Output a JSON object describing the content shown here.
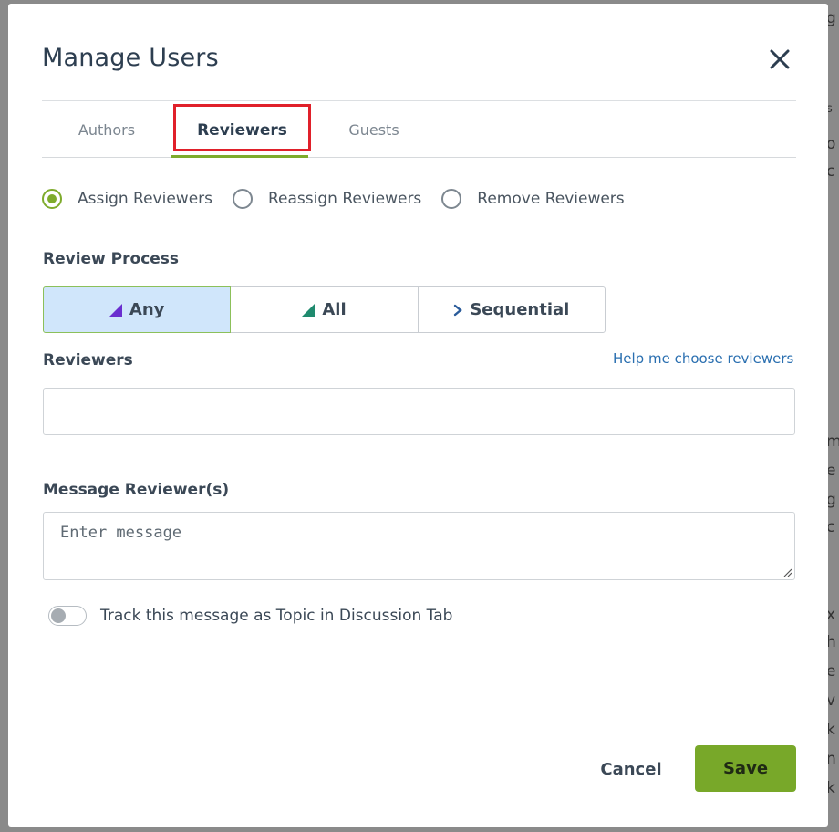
{
  "dialog": {
    "title": "Manage Users",
    "close_icon": "close-icon"
  },
  "tabs": [
    {
      "label": "Authors",
      "active": false
    },
    {
      "label": "Reviewers",
      "active": true
    },
    {
      "label": "Guests",
      "active": false
    }
  ],
  "assign_mode": {
    "options": [
      {
        "label": "Assign Reviewers",
        "checked": true
      },
      {
        "label": "Reassign Reviewers",
        "checked": false
      },
      {
        "label": "Remove Reviewers",
        "checked": false
      }
    ]
  },
  "review_process": {
    "label": "Review Process",
    "options": [
      {
        "label": "Any",
        "icon": "triangle-icon",
        "icon_color": "#6a2ecf",
        "selected": true
      },
      {
        "label": "All",
        "icon": "triangle-icon",
        "icon_color": "#1f8a6e",
        "selected": false
      },
      {
        "label": "Sequential",
        "icon": "chevron-right-icon",
        "icon_color": "#2a5b9a",
        "selected": false
      }
    ]
  },
  "reviewers": {
    "label": "Reviewers",
    "help_link": "Help me choose reviewers",
    "value": ""
  },
  "message": {
    "label": "Message Reviewer(s)",
    "placeholder": "Enter message",
    "value": ""
  },
  "track_toggle": {
    "label": "Track this message as Topic in Discussion Tab",
    "on": false
  },
  "footer": {
    "cancel_label": "Cancel",
    "save_label": "Save"
  },
  "colors": {
    "accent": "#78a829",
    "highlight_box": "#e0202a",
    "selected_segment": "#d0e6fb",
    "link": "#2a6fb0"
  }
}
